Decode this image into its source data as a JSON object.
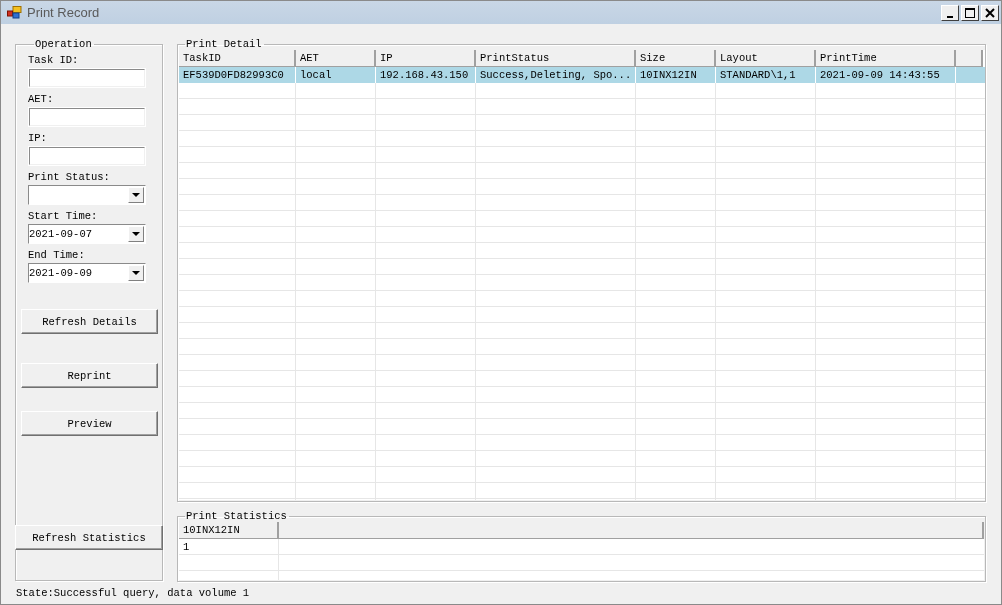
{
  "window": {
    "title": "Print Record"
  },
  "operation": {
    "title": "Operation",
    "fields": [
      {
        "kind": "text",
        "label": "Task ID:"
      },
      {
        "kind": "text",
        "label": "AET:"
      },
      {
        "kind": "text",
        "label": "IP:"
      },
      {
        "kind": "dropdown",
        "label": "Print Status:"
      },
      {
        "kind": "dropdown",
        "label": "Start Time:",
        "value": "2021-09-07"
      },
      {
        "kind": "dropdown",
        "label": "End Time:",
        "value": "2021-09-09"
      }
    ],
    "buttons": [
      "Refresh Details",
      "Reprint",
      "Preview"
    ],
    "refresh_statistics": "Refresh Statistics"
  },
  "print_detail": {
    "title": "Print Detail",
    "columns": [
      "TaskID",
      "AET",
      "IP",
      "PrintStatus",
      "Size",
      "Layout",
      "PrintTime"
    ],
    "rows": [
      {
        "selected": true,
        "cells": [
          "EF539D0FD82993C0",
          "local",
          "192.168.43.150",
          "Success,Deleting, Spo...",
          "10INX12IN",
          "STANDARD\\1,1",
          "2021-09-09 14:43:55"
        ]
      }
    ]
  },
  "print_statistics": {
    "title": "Print Statistics",
    "columns": [
      "10INX12IN"
    ],
    "rows": [
      [
        "1"
      ]
    ]
  },
  "status_bar": "State:Successful query, data volume 1"
}
